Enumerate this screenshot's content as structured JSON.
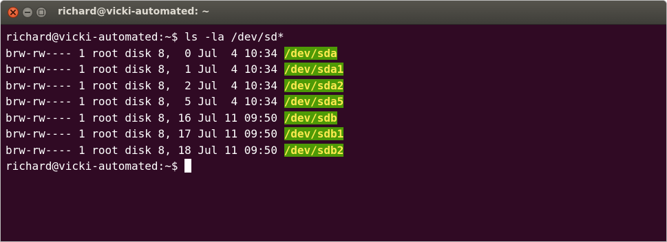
{
  "window": {
    "title": "richard@vicki-automated: ~"
  },
  "colors": {
    "terminal_background": "#300a24",
    "terminal_text": "#ffffff",
    "block_device_fg": "#fce94f",
    "block_device_bg": "#4e9a06"
  },
  "terminal": {
    "command_prompt": "richard@vicki-automated:~$ ",
    "command": "ls -la /dev/sd*",
    "entries": [
      {
        "meta": "brw-rw---- 1 root disk 8,  0 Jul  4 10:34 ",
        "name": "/dev/sda"
      },
      {
        "meta": "brw-rw---- 1 root disk 8,  1 Jul  4 10:34 ",
        "name": "/dev/sda1"
      },
      {
        "meta": "brw-rw---- 1 root disk 8,  2 Jul  4 10:34 ",
        "name": "/dev/sda2"
      },
      {
        "meta": "brw-rw---- 1 root disk 8,  5 Jul  4 10:34 ",
        "name": "/dev/sda5"
      },
      {
        "meta": "brw-rw---- 1 root disk 8, 16 Jul 11 09:50 ",
        "name": "/dev/sdb"
      },
      {
        "meta": "brw-rw---- 1 root disk 8, 17 Jul 11 09:50 ",
        "name": "/dev/sdb1"
      },
      {
        "meta": "brw-rw---- 1 root disk 8, 18 Jul 11 09:50 ",
        "name": "/dev/sdb2"
      }
    ],
    "final_prompt": "richard@vicki-automated:~$ "
  }
}
